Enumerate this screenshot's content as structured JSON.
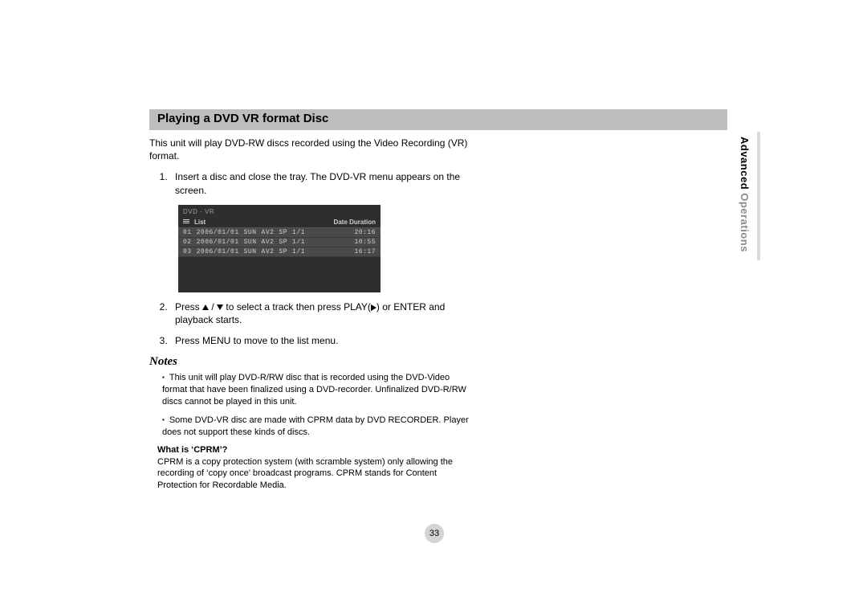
{
  "sideTab": {
    "bold": "Advanced",
    "light": " Operations"
  },
  "header": {
    "title": "Playing a DVD VR format Disc"
  },
  "intro": "This unit will play DVD-RW discs recorded using the Video Recording (VR) format.",
  "steps": {
    "s1": "Insert a disc and close the tray. The DVD-VR menu appears on the screen.",
    "s2a": "Press ",
    "s2b": " / ",
    "s2c": " to select a track then press PLAY(",
    "s2d": ") or ENTER and playback starts.",
    "s3": "Press MENU to move to the list menu."
  },
  "screenshot": {
    "topLabel": "DVD - VR",
    "headerLeft": "List",
    "headerRight": "Date Duration",
    "rows": [
      {
        "num": "01",
        "date": "2006/01/01",
        "day": "SUN",
        "src": "AV2",
        "sp": "SP",
        "frac": "1/1",
        "dur": "20:16"
      },
      {
        "num": "02",
        "date": "2006/01/01",
        "day": "SUN",
        "src": "AV2",
        "sp": "SP",
        "frac": "1/1",
        "dur": "10:55"
      },
      {
        "num": "03",
        "date": "2006/01/01",
        "day": "SUN",
        "src": "AV2",
        "sp": "SP",
        "frac": "1/1",
        "dur": "16:17"
      }
    ]
  },
  "notesLabel": "Notes",
  "notes": {
    "n1": "This unit will play DVD-R/RW disc that is recorded using the DVD-Video format that have been finalized using a DVD-recorder. Unfinalized DVD-R/RW discs cannot be played in this unit.",
    "n2": "Some DVD-VR disc are made with CPRM data by DVD RECORDER. Player does not support these kinds of discs."
  },
  "cprm": {
    "heading": "What is ‘CPRM’?",
    "body": "CPRM is a copy protection system (with scramble system) only allowing the recording of ‘copy once’ broadcast programs. CPRM stands for Content Protection for Recordable Media."
  },
  "pageNumber": "33"
}
